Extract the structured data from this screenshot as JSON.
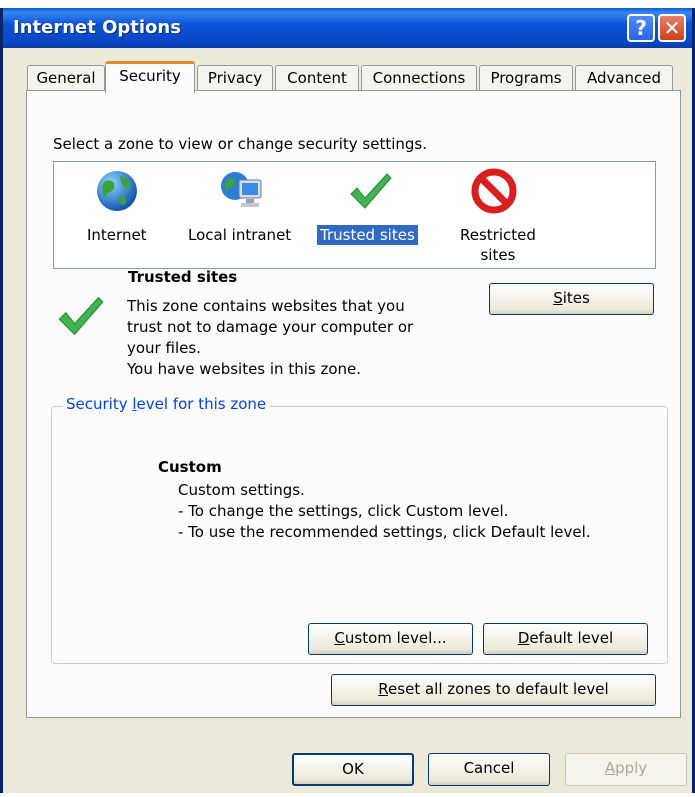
{
  "window": {
    "title": "Internet Options"
  },
  "titlebar_buttons": {
    "help": "?",
    "close": "✕"
  },
  "tabs": [
    {
      "label": "General"
    },
    {
      "label": "Security"
    },
    {
      "label": "Privacy"
    },
    {
      "label": "Content"
    },
    {
      "label": "Connections"
    },
    {
      "label": "Programs"
    },
    {
      "label": "Advanced"
    }
  ],
  "security": {
    "instruction": "Select a zone to view or change security settings.",
    "zones": [
      {
        "label": "Internet",
        "icon": "globe-icon"
      },
      {
        "label": "Local intranet",
        "icon": "intranet-icon"
      },
      {
        "label": "Trusted sites",
        "icon": "checkmark-icon",
        "selected": true
      },
      {
        "label_line1": "Restricted",
        "label_line2": "sites",
        "icon": "restricted-icon"
      }
    ],
    "zone_info": {
      "title": "Trusted sites",
      "desc_lines": [
        "This zone contains websites that you",
        "trust not to damage your computer or",
        "your files.",
        "You have websites in this zone."
      ]
    },
    "sites_button": {
      "first": "S",
      "rest": "ites"
    },
    "level_group": {
      "legend_pre": "Security ",
      "legend_accel": "l",
      "legend_post": "evel for this zone",
      "level_title": "Custom",
      "lines": [
        "Custom settings.",
        "- To change the settings, click Custom level.",
        "- To use the recommended settings, click Default level."
      ],
      "custom_level_button": {
        "first": "C",
        "rest": "ustom level..."
      },
      "default_level_button": {
        "first": "D",
        "rest": "efault level"
      }
    },
    "reset_button": {
      "first": "R",
      "rest": "eset all zones to default level"
    }
  },
  "footer": {
    "ok": "OK",
    "cancel": "Cancel",
    "apply_first": "A",
    "apply_rest": "pply"
  },
  "colors": {
    "titlebar": "#0a54d8",
    "selection": "#316ac5",
    "group_legend": "#0046d5",
    "checkmark": "#3fb34f",
    "restricted": "#d81e1e"
  }
}
